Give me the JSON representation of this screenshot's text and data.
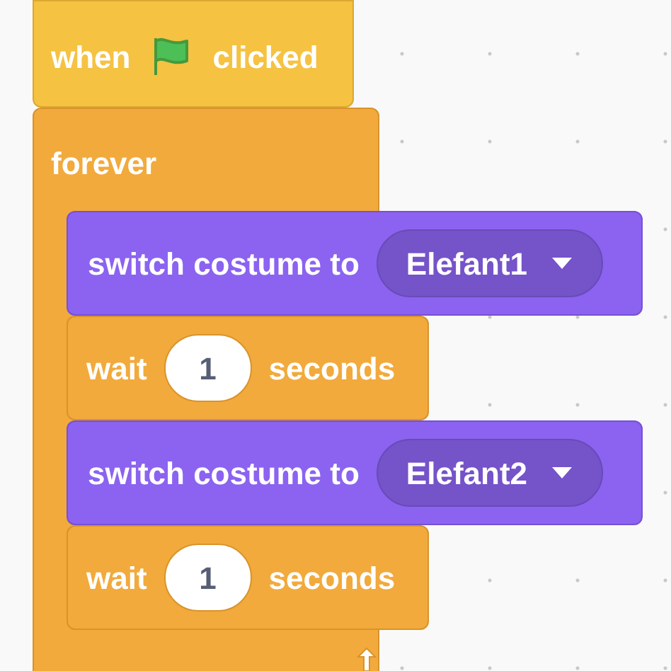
{
  "hat": {
    "label_before": "when",
    "label_after": "clicked"
  },
  "loop": {
    "label": "forever",
    "blocks": [
      {
        "kind": "costume",
        "label": "switch costume to",
        "value": "Elefant1"
      },
      {
        "kind": "wait",
        "label_before": "wait",
        "value": "1",
        "label_after": "seconds"
      },
      {
        "kind": "costume",
        "label": "switch costume to",
        "value": "Elefant2"
      },
      {
        "kind": "wait",
        "label_before": "wait",
        "value": "1",
        "label_after": "seconds"
      }
    ]
  }
}
